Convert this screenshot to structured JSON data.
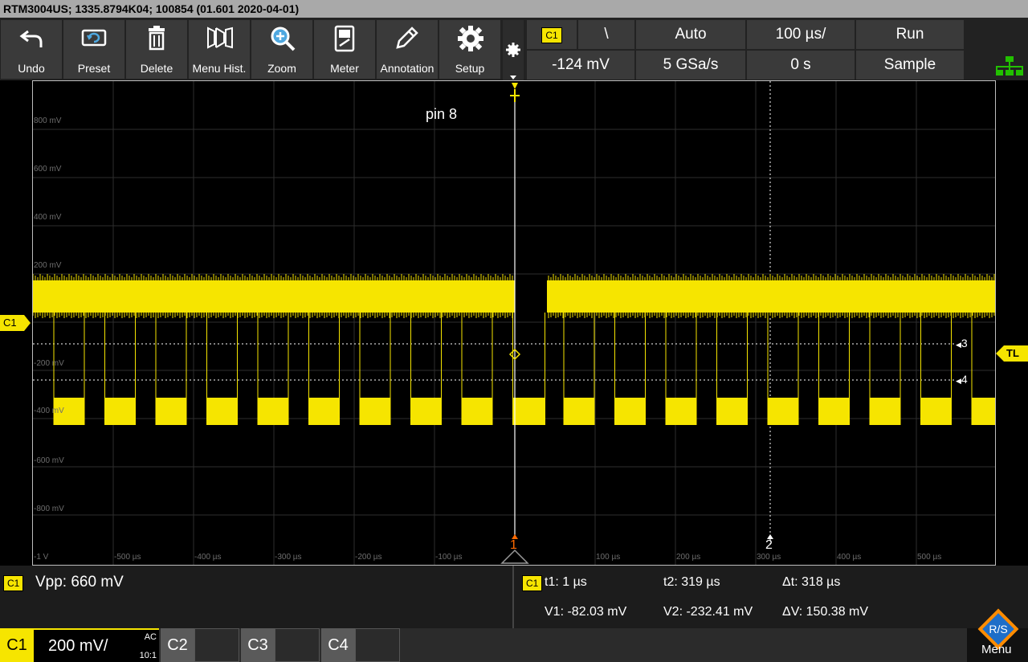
{
  "title": "RTM3004US; 1335.8794K04; 100854 (01.601 2020-04-01)",
  "toolbar": {
    "items": [
      {
        "label": "Undo",
        "icon": "undo-icon"
      },
      {
        "label": "Preset",
        "icon": "preset-icon"
      },
      {
        "label": "Delete",
        "icon": "trash-icon"
      },
      {
        "label": "Menu Hist.",
        "icon": "menu-history-icon"
      },
      {
        "label": "Zoom",
        "icon": "zoom-icon"
      },
      {
        "label": "Meter",
        "icon": "meter-icon"
      },
      {
        "label": "Annotation",
        "icon": "pencil-icon"
      },
      {
        "label": "Setup",
        "icon": "gear-icon"
      }
    ]
  },
  "status": {
    "trigger_source": "C1",
    "trigger_slope": "\\",
    "trigger_mode": "Auto",
    "timebase": "100 µs/",
    "run_state": "Run",
    "trigger_level": "-124 mV",
    "sample_rate": "5 GSa/s",
    "trigger_offset": "0 s",
    "acq_mode": "Sample"
  },
  "screen": {
    "annotation": "pin 8",
    "channel_marker": "C1",
    "trigger_level_marker": "TL",
    "cursor_labels": [
      "3",
      "4",
      "1",
      "2"
    ],
    "y_labels": [
      "800 mV",
      "600 mV",
      "400 mV",
      "200 mV",
      "-200 mV",
      "-400 mV",
      "-600 mV",
      "-800 mV",
      "-1 V"
    ],
    "x_labels": [
      "-500 µs",
      "-400 µs",
      "-300 µs",
      "-200 µs",
      "-100 µs",
      "100 µs",
      "200 µs",
      "300 µs",
      "400 µs",
      "500 µs"
    ]
  },
  "measure": {
    "left_channel": "C1",
    "vpp": "Vpp: 660 mV",
    "cursor_channel": "C1",
    "t1": "t1: 1 µs",
    "t2": "t2: 319 µs",
    "dt": "Δt: 318 µs",
    "v1": "V1: -82.03 mV",
    "v2": "V2: -232.41 mV",
    "dv": "ΔV: 150.38 mV"
  },
  "bottom": {
    "c1": "C1",
    "c1_scale": "200 mV/",
    "c1_coupling": "AC",
    "c1_probe": "10:1",
    "c2": "C2",
    "c3": "C3",
    "c4": "C4",
    "menu": "Menu"
  },
  "colors": {
    "channel1": "#f6e500",
    "trigger": "#f6e500",
    "cursor_marker": "#ff6a00"
  }
}
